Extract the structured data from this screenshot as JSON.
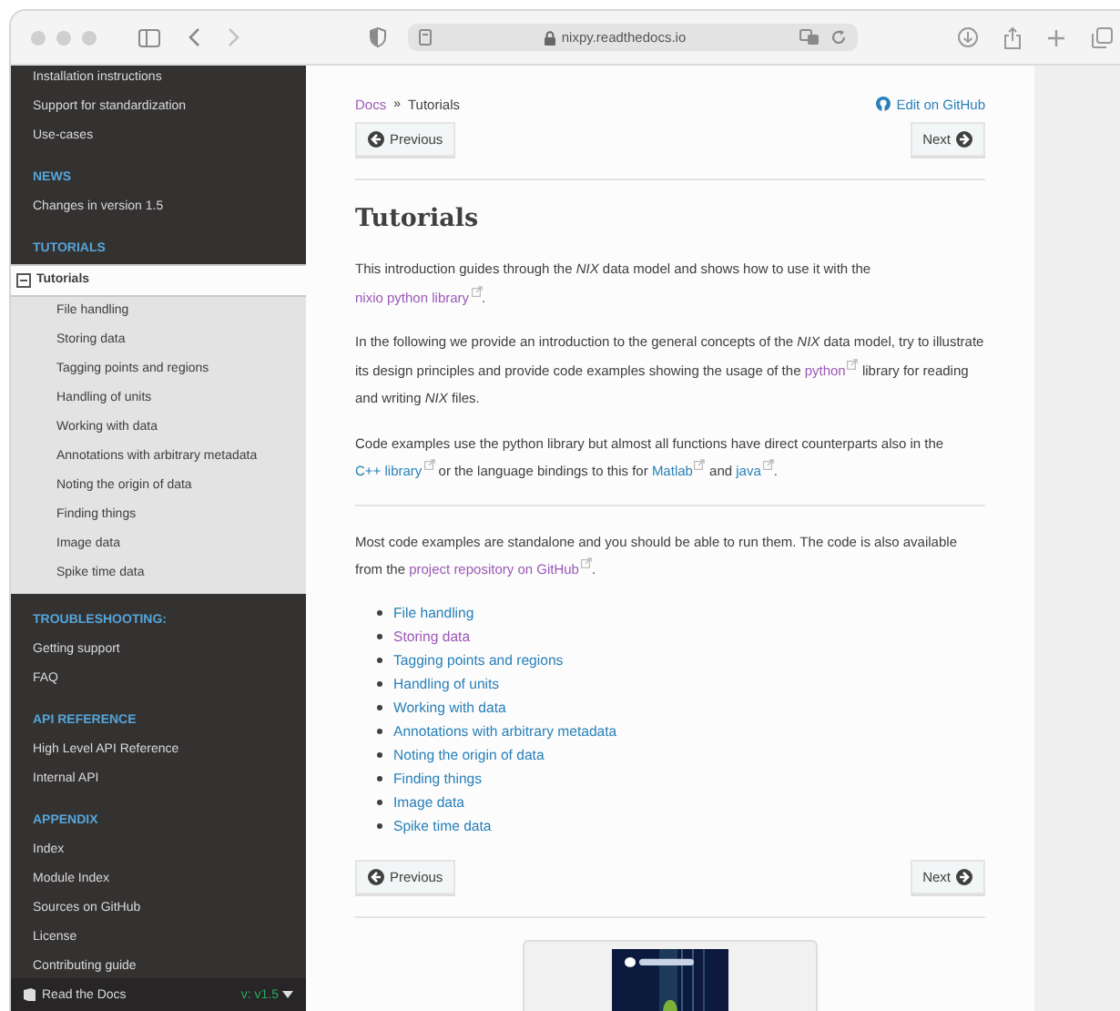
{
  "browser": {
    "url": "nixpy.readthedocs.io"
  },
  "sidebar": {
    "sections": [
      {
        "items": [
          {
            "label": "Installation instructions",
            "selected": false
          },
          {
            "label": "Support for standardization",
            "selected": false
          },
          {
            "label": "Use-cases",
            "selected": false
          }
        ]
      },
      {
        "caption": "NEWS",
        "items": [
          {
            "label": "Changes in version 1.5",
            "selected": false
          }
        ]
      },
      {
        "caption": "TUTORIALS",
        "items": [
          {
            "label": "Tutorials",
            "selected": true,
            "expanded": true,
            "children": [
              {
                "label": "File handling",
                "selected": false
              },
              {
                "label": "Storing data",
                "selected": false
              },
              {
                "label": "Tagging points and regions",
                "selected": false
              },
              {
                "label": "Handling of units",
                "selected": false
              },
              {
                "label": "Working with data",
                "selected": false
              },
              {
                "label": "Annotations with arbitrary metadata",
                "selected": false
              },
              {
                "label": "Noting the origin of data",
                "selected": false
              },
              {
                "label": "Finding things",
                "selected": false
              },
              {
                "label": "Image data",
                "selected": false
              },
              {
                "label": "Spike time data",
                "selected": false
              }
            ]
          }
        ]
      },
      {
        "caption": "TROUBLESHOOTING:",
        "items": [
          {
            "label": "Getting support",
            "selected": false
          },
          {
            "label": "FAQ",
            "selected": false
          }
        ]
      },
      {
        "caption": "API REFERENCE",
        "items": [
          {
            "label": "High Level API Reference",
            "selected": false
          },
          {
            "label": "Internal API",
            "selected": false
          }
        ]
      },
      {
        "caption": "APPENDIX",
        "items": [
          {
            "label": "Index",
            "selected": false
          },
          {
            "label": "Module Index",
            "selected": false
          },
          {
            "label": "Sources on GitHub",
            "selected": false
          },
          {
            "label": "License",
            "selected": false
          },
          {
            "label": "Contributing guide",
            "selected": false
          }
        ]
      }
    ],
    "footer": {
      "label": "Read the Docs",
      "version": "v: v1.5"
    }
  },
  "breadcrumb": {
    "root": "Docs",
    "separator": "»",
    "current": "Tutorials"
  },
  "edit_link": "Edit on GitHub",
  "nav_top": {
    "previous": "Previous",
    "next": "Next"
  },
  "title": "Tutorials",
  "sections": [
    {
      "paragraphs": [
        [
          {
            "kind": "text",
            "text": "This introduction guides through the *NIX* data model and shows how to use it with the "
          },
          {
            "kind": "link",
            "text": "nixio python library",
            "visited": true
          },
          {
            "kind": "text",
            "text": "."
          }
        ],
        [
          {
            "kind": "text",
            "text": "In the following we provide an introduction to the general concepts of the *NIX* data model, try to illustrate its design principles and provide code examples showing the usage of the "
          },
          {
            "kind": "link",
            "text": "python",
            "visited": true
          },
          {
            "kind": "text",
            "text": " library for reading and writing *NIX* files."
          }
        ],
        [
          {
            "kind": "text",
            "text": "Code examples use the python library but almost all functions have direct counterparts also in the "
          },
          {
            "kind": "link",
            "text": "C++ library",
            "visited": false
          },
          {
            "kind": "text",
            "text": " or the language bindings to this for "
          },
          {
            "kind": "link",
            "text": "Matlab",
            "visited": false
          },
          {
            "kind": "text",
            "text": " and "
          },
          {
            "kind": "link",
            "text": "java",
            "visited": false
          },
          {
            "kind": "text",
            "text": "."
          }
        ]
      ]
    },
    {
      "paragraphs": [
        [
          {
            "kind": "text",
            "text": "Most code examples are standalone and you should be able to run them. The code is also available from the "
          },
          {
            "kind": "link",
            "text": "project repository on GitHub",
            "visited": true
          },
          {
            "kind": "text",
            "text": "."
          }
        ]
      ]
    }
  ],
  "toc": [
    {
      "label": "File handling",
      "visited": false
    },
    {
      "label": "Storing data",
      "visited": true
    },
    {
      "label": "Tagging points and regions",
      "visited": false
    },
    {
      "label": "Handling of units",
      "visited": false
    },
    {
      "label": "Working with data",
      "visited": false
    },
    {
      "label": "Annotations with arbitrary metadata",
      "visited": false
    },
    {
      "label": "Noting the origin of data",
      "visited": false
    },
    {
      "label": "Finding things",
      "visited": false
    },
    {
      "label": "Image data",
      "visited": false
    },
    {
      "label": "Spike time data",
      "visited": false
    }
  ],
  "nav_bottom": {
    "previous": "Previous",
    "next": "Next"
  }
}
